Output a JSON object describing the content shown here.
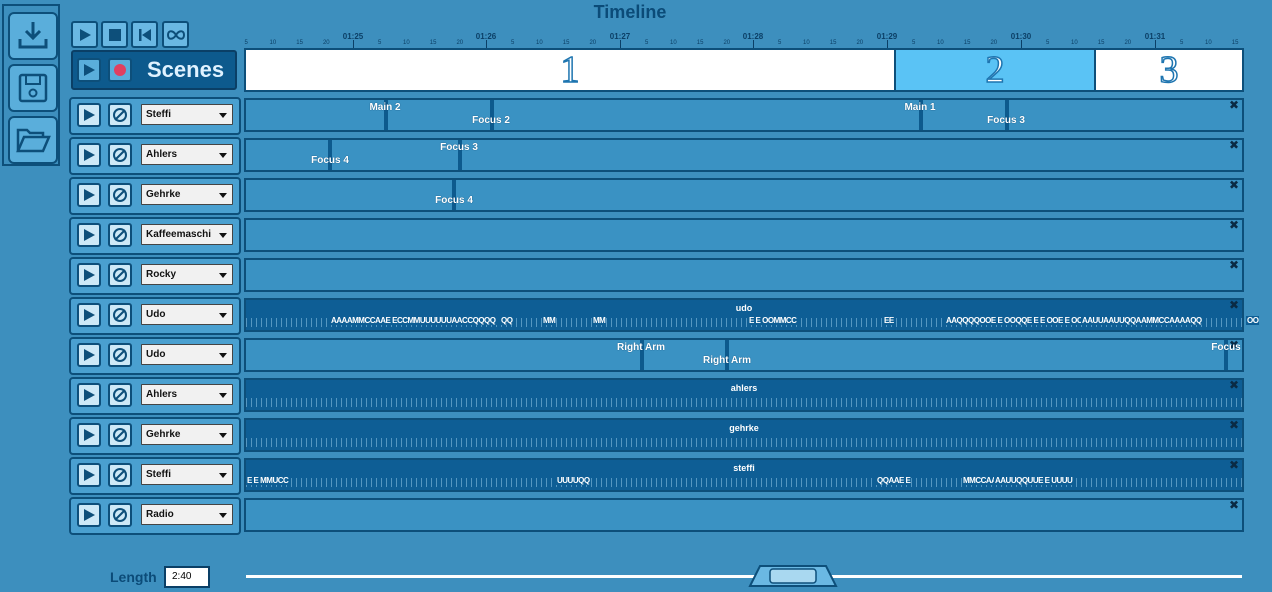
{
  "title": "Timeline",
  "colors": {
    "background": "#3d8fbe",
    "accent_dark": "#0d4f7a",
    "scene_selected": "#5ac3f5"
  },
  "side_tools": [
    {
      "icon": "download-icon"
    },
    {
      "icon": "save-icon"
    },
    {
      "icon": "open-folder-icon"
    }
  ],
  "transport": [
    "play-icon",
    "stop-icon",
    "skip-back-icon",
    "loop-icon"
  ],
  "scenes": {
    "label": "Scenes",
    "items": [
      {
        "number": "1",
        "selected": false
      },
      {
        "number": "2",
        "selected": true
      },
      {
        "number": "3",
        "selected": false
      }
    ]
  },
  "ruler": {
    "major": [
      "01:25",
      "01:26",
      "01:27",
      "01:28",
      "01:29",
      "01:30",
      "01:31"
    ],
    "minor": [
      "5",
      "10",
      "15",
      "20",
      "5",
      "10",
      "15",
      "20",
      "5",
      "10",
      "15",
      "20",
      "5",
      "10",
      "15",
      "20",
      "5",
      "10",
      "15",
      "20",
      "5",
      "10",
      "15",
      "20",
      "5",
      "10",
      "15",
      "20",
      "5",
      "10",
      "15"
    ]
  },
  "tracks": [
    {
      "name": "Steffi",
      "markers": [
        "Main 2",
        "Focus 2",
        "Main 1",
        "Focus 3"
      ]
    },
    {
      "name": "Ahlers",
      "markers": [
        "Focus 4",
        "Focus 3"
      ]
    },
    {
      "name": "Gehrke",
      "markers": [
        "Focus 4"
      ]
    },
    {
      "name": "Kaffeemaschi",
      "markers": []
    },
    {
      "name": "Rocky",
      "markers": []
    },
    {
      "name": "Udo",
      "audio_title": "udo",
      "words": [
        "AAAAMMCCAAE ECCMMUUUUUUAACCQQQQ",
        "QQ",
        "MM",
        "MM",
        "E E OOMMCC",
        "EE",
        "AAQQQQOOE E OOQQE E E OOE E OOUUQQMM",
        "AAUUAAUUQQAAMMCCAAAAQQ",
        "OO"
      ]
    },
    {
      "name": "Udo",
      "markers": [
        "Right Arm",
        "Right Arm",
        "Focus"
      ]
    },
    {
      "name": "Ahlers",
      "audio_title": "ahlers"
    },
    {
      "name": "Gehrke",
      "audio_title": "gehrke"
    },
    {
      "name": "Steffi",
      "audio_title": "steffi",
      "words": [
        "E E MMUCC",
        "UUUUQQ",
        "QQAAE E",
        "MMCCAAAACCE E",
        "AAUUQQUUE E UUUU"
      ]
    },
    {
      "name": "Radio",
      "markers": []
    }
  ],
  "length": {
    "label": "Length",
    "value": "2:40"
  }
}
